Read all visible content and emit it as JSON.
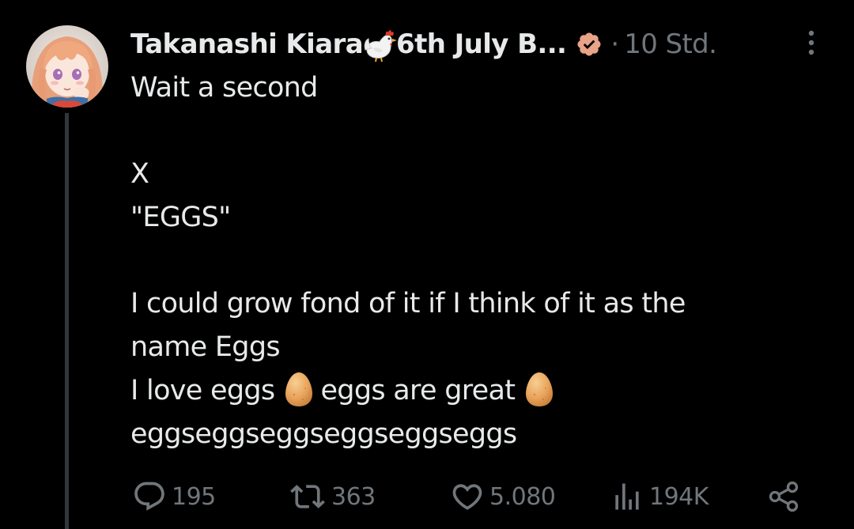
{
  "tweet": {
    "author": {
      "display_name": "Takanashi Kiara",
      "name_suffix": "6th July B...",
      "verified": true,
      "avatar_icon": "anime-avatar-icon"
    },
    "meta_separator": "·",
    "timestamp": "10 Std.",
    "lines": [
      "Wait a second",
      "",
      "X",
      "\"EGGS\"",
      "",
      "I could grow fond of it if I think of it as the",
      "name Eggs"
    ],
    "love_line": {
      "part1": "I love eggs",
      "part2": "eggs are great"
    },
    "last_line": "eggseggseggseggseggseggs"
  },
  "actions": {
    "replies": "195",
    "reposts": "363",
    "likes": "5.080",
    "views": "194K"
  },
  "colors": {
    "background": "#000000",
    "text_primary": "#e7e9ea",
    "text_secondary": "#71767b",
    "verified_badge": "#e8a388",
    "thread_line": "#333639"
  }
}
